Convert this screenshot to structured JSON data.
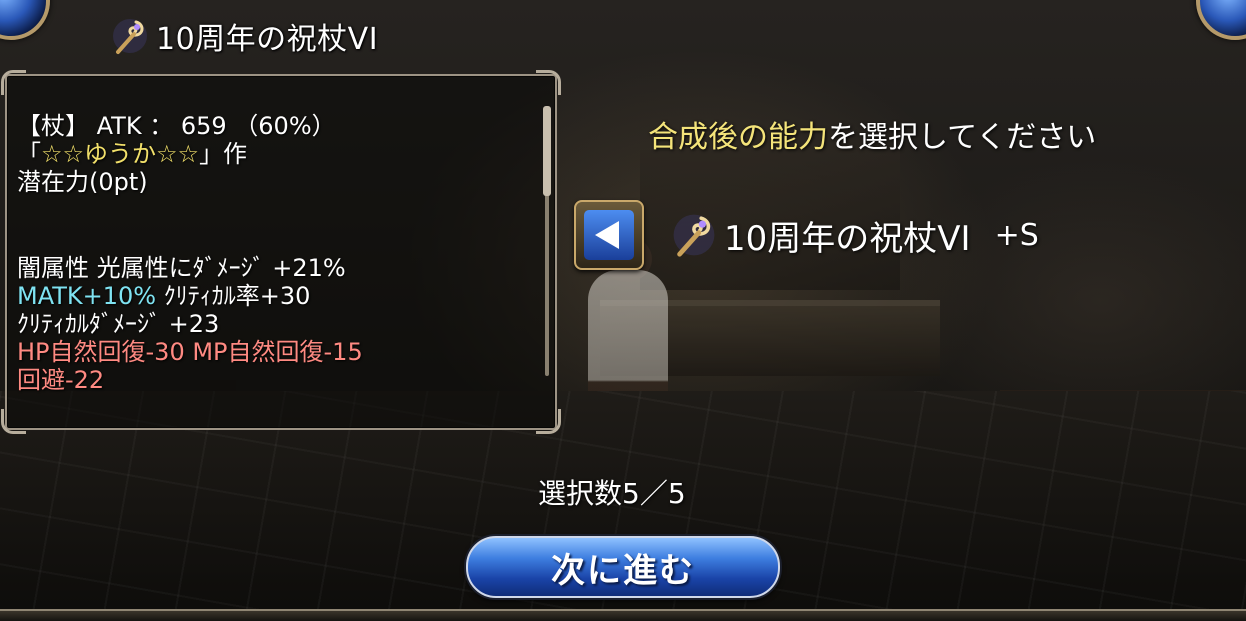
{
  "header": {
    "item_name": "10周年の祝杖VI"
  },
  "info_panel": {
    "line1": "【杖】 ATK ： 659 （60%）",
    "line2_open": "「",
    "line2_creator": "☆☆ゆうか☆☆",
    "line2_close": "」作",
    "line3": "潜在力(0pt)",
    "effects": [
      {
        "text": "闇属性 光属性にﾀﾞﾒｰｼﾞ +21%",
        "color": "white"
      },
      {
        "segments": [
          {
            "text": "MATK+10%",
            "color": "cyan"
          },
          {
            "text": " ｸﾘﾃｨｶﾙ率+30",
            "color": "white"
          }
        ]
      },
      {
        "text": "ｸﾘﾃｨｶﾙﾀﾞﾒｰｼﾞ +23",
        "color": "white"
      },
      {
        "text": "HP自然回復-30 MP自然回復-15",
        "color": "red"
      },
      {
        "text": "回避-22",
        "color": "red"
      }
    ]
  },
  "prompt": {
    "highlight": "合成後の能力",
    "rest": "を選択してください"
  },
  "selection": {
    "item_name": "10周年の祝杖VI",
    "suffix": "+S",
    "count": "選択数5／5"
  },
  "buttons": {
    "next_label": "次に進む"
  },
  "colors": {
    "accent_gold": "#f4e47a",
    "cyan": "#7fe3f2",
    "red": "#ff8a82",
    "button_blue": "#3e7ee0"
  },
  "icons": {
    "item": "staff-icon",
    "back": "left-arrow-icon"
  }
}
